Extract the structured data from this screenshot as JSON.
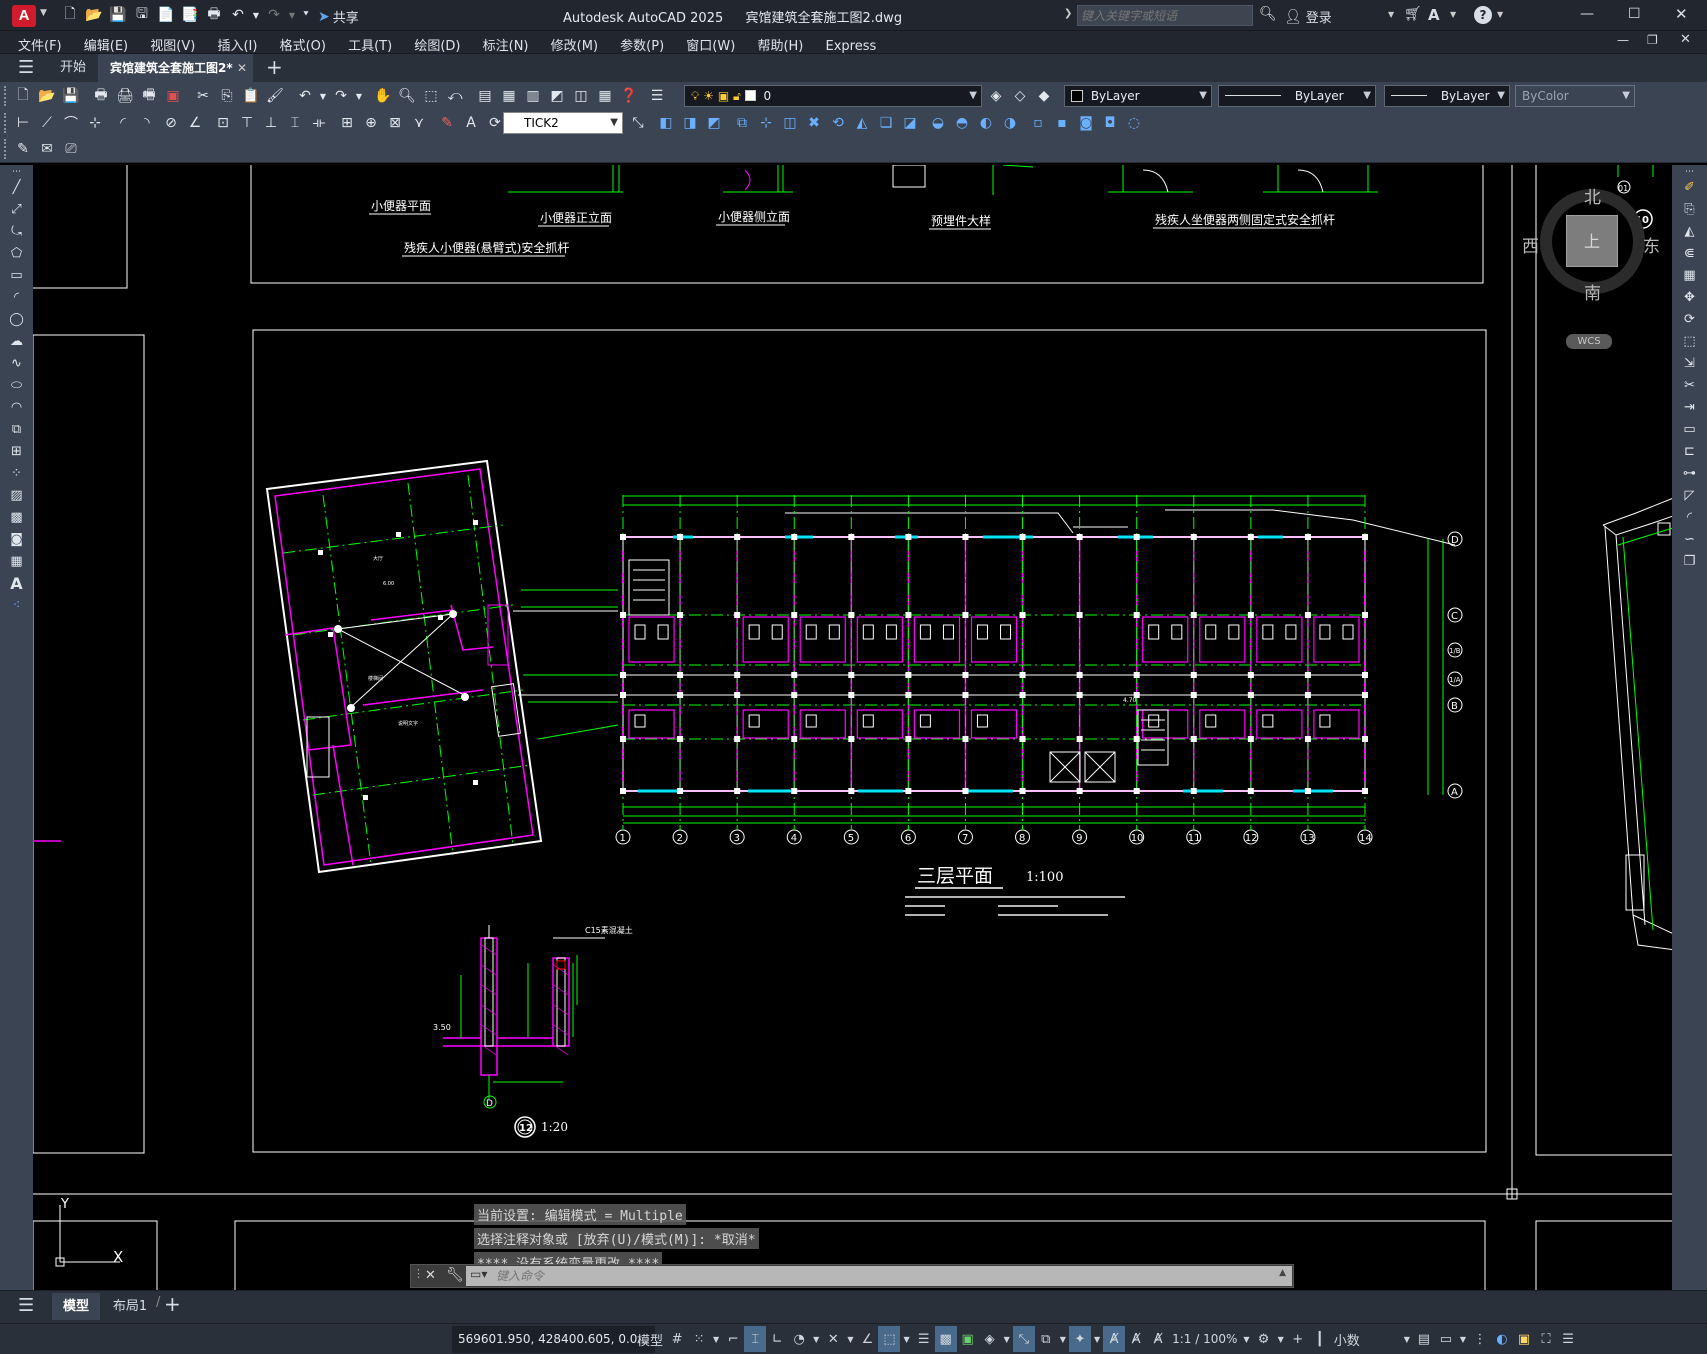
{
  "app": {
    "title": "Autodesk AutoCAD 2025",
    "file": "宾馆建筑全套施工图2.dwg",
    "share_label": "共享",
    "search_placeholder": "键入关键字或短语",
    "login_label": "登录"
  },
  "menu": [
    "文件(F)",
    "编辑(E)",
    "视图(V)",
    "插入(I)",
    "格式(O)",
    "工具(T)",
    "绘图(D)",
    "标注(N)",
    "修改(M)",
    "参数(P)",
    "窗口(W)",
    "帮助(H)",
    "Express"
  ],
  "doctabs": {
    "start": "开始",
    "active": "宾馆建筑全套施工图2*",
    "new": "+"
  },
  "layer": {
    "name": "0"
  },
  "properties": {
    "color": "ByLayer",
    "linetype": "ByLayer",
    "lineweight": "ByLayer",
    "plotstyle": "ByColor"
  },
  "dimstyle": "TICK2",
  "viewcube": {
    "north": "北",
    "south": "南",
    "east": "东",
    "west": "西",
    "top": "上",
    "wcs": "WCS"
  },
  "drawing": {
    "labels_top": [
      "小便器平面",
      "小便器正立面",
      "小便器侧立面",
      "预埋件大样",
      "残疾人坐便器两侧固定式安全抓杆",
      "残疾人小便器(悬臂式)安全抓杆"
    ],
    "plan_title": "三层平面",
    "plan_scale": "1:100",
    "detail_scale": "1:20",
    "detail_num": "12",
    "detail_axis": "D",
    "detail_note1": "C15素混凝土",
    "detail_level": "3.50",
    "axis_bottom": [
      "1",
      "2",
      "3",
      "4",
      "5",
      "6",
      "7",
      "8",
      "9",
      "10",
      "11",
      "12",
      "13",
      "14"
    ],
    "axis_right": [
      "D",
      "C",
      "B",
      "A"
    ],
    "axis_right_sub": [
      "1/B",
      "1/A"
    ],
    "dim_label": "4.70",
    "right_marker": "10",
    "right_marker_sub": "01"
  },
  "command": {
    "lines": [
      "当前设置: 编辑模式 = Multiple",
      "选择注释对象或 [放弃(U)/模式(M)]: *取消*",
      "**** 没有系统变量更改 ****"
    ],
    "placeholder": "键入命令"
  },
  "ucs": {
    "x": "X",
    "y": "Y"
  },
  "layouts": {
    "model": "模型",
    "layout1": "布局1",
    "add": "+"
  },
  "status": {
    "coords": "569601.950, 428400.605, 0.0...",
    "model": "模型",
    "scale": "1:1 / 100%",
    "units": "小数"
  }
}
